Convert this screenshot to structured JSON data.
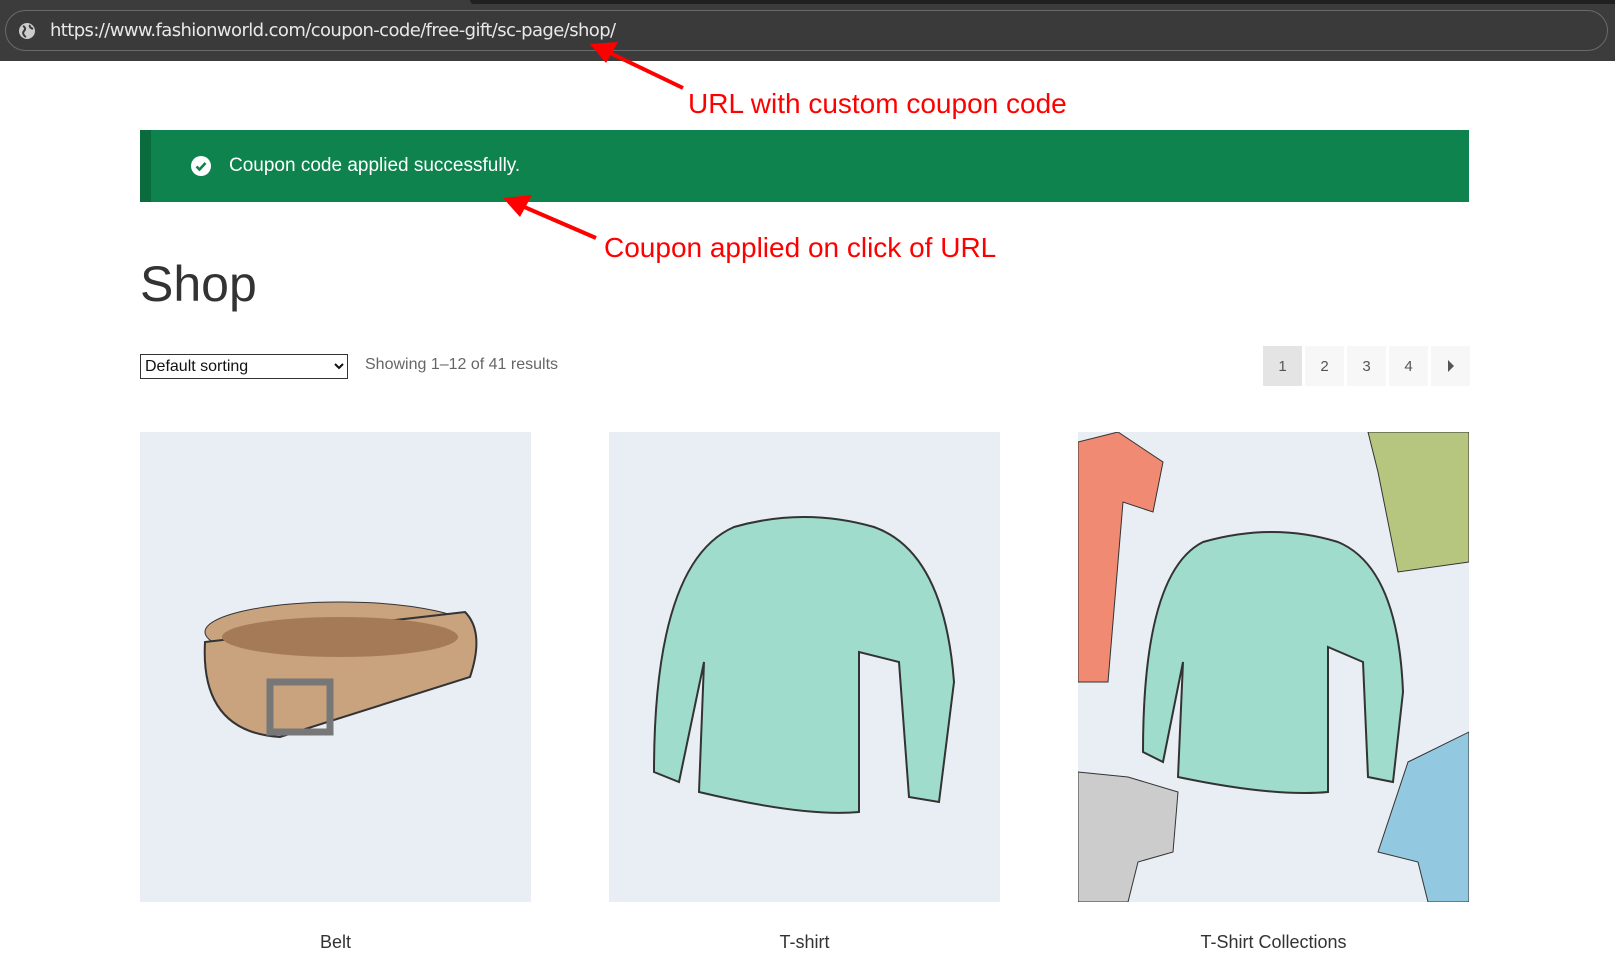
{
  "browser": {
    "url": "https://www.fashionworld.com/coupon-code/free-gift/sc-page/shop/"
  },
  "notice": {
    "message": "Coupon code applied successfully."
  },
  "annotations": {
    "url_note": "URL with custom coupon code",
    "applied_note": "Coupon applied on click of URL"
  },
  "shop": {
    "title": "Shop",
    "sorting": "Default sorting",
    "result_count": "Showing 1–12 of 41 results",
    "pagination": [
      "1",
      "2",
      "3",
      "4"
    ],
    "current_page": "1"
  },
  "products": [
    {
      "name": "Belt"
    },
    {
      "name": "T-shirt"
    },
    {
      "name": "T-Shirt Collections"
    }
  ],
  "colors": {
    "notice_bg": "#0f834d",
    "annotation": "#ff0000"
  }
}
